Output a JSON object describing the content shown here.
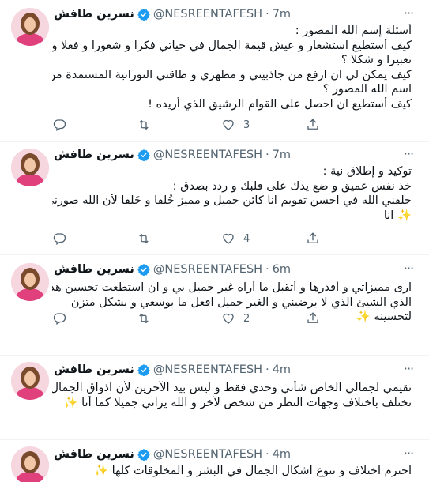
{
  "author": {
    "name": "نسرين طافش",
    "handle": "@NESREENTAFESH"
  },
  "icons": {
    "more": "more-horizontal-icon",
    "verified": "verified-badge-icon",
    "reply": "reply-icon",
    "retweet": "retweet-icon",
    "like": "like-heart-icon",
    "share": "share-icon",
    "emoji": "glowing-star-emoji-icon"
  },
  "colors": {
    "verified": "#1d9bf0",
    "muted_text": "#536471",
    "divider": "#eff3f4"
  },
  "tweets": [
    {
      "time": "7m",
      "lines": [
        "أسئلة إسم الله المصور :",
        "كيف أستطيع استشعار و عيش قيمة الجمال في حياتي فكرا و شعورا و فعلا و",
        "تعبيرا و شكلا ؟",
        "كيف يمكن لي ان ارفع من جاذبيتي و مظهري و طاقتي النورانية المستمدة من",
        "اسم الله المصور ؟",
        "كيف أستطيع ان احصل على القوام الرشيق الذي أريده !"
      ],
      "reply_count": "",
      "retweet_count": "",
      "like_count": "3"
    },
    {
      "time": "7m",
      "lines": [
        "توكيد و إطلاق نية :",
        "خذ نفس عميق و ضع يدك على قلبك و ردد بصدق :",
        "خلقني الله في احسن تقويم انا كائن جميل و مميز خُلقا و خَلقا لأن الله صورني كما",
        "انا"
      ],
      "reply_count": "",
      "retweet_count": "",
      "like_count": "4"
    },
    {
      "time": "6m",
      "lines": [
        "ارى مميزاتي و أقدرها و أتقبل ما أراه غير جميل بي و ان استطعت تحسين هذا",
        "الذي الشيئ الذي لا يرضيني و الغير جميل افعل ما بوسعي و بشكل متزن",
        "لتحسينه"
      ],
      "reply_count": "",
      "retweet_count": "",
      "like_count": "2"
    },
    {
      "time": "4m",
      "lines": [
        "تقيمي لجمالي الخاص شأني وحدي  فقط و ليس بيد الآخرين لأن اذواق الجمال",
        "تختلف باختلاف وجهات النظر من شخص لآخر و الله يراني جميلا كما أنا"
      ],
      "reply_count": "",
      "retweet_count": "",
      "like_count": ""
    },
    {
      "time": "4m",
      "lines": [
        "احترم اختلاف و تنوع اشكال الجمال في البشر و المخلوقات كلها"
      ],
      "reply_count": "",
      "retweet_count": "",
      "like_count": ""
    }
  ]
}
